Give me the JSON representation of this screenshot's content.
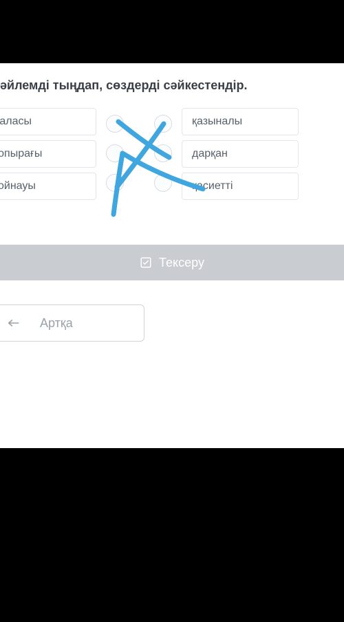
{
  "instruction": "әйлемді тыңдап, сөздерді сәйкестендір.",
  "match": {
    "left": [
      "даласы",
      "топырағы",
      "қойнауы"
    ],
    "right": [
      "қазыналы",
      "дарқан",
      "қасиетті"
    ],
    "connections": [
      {
        "from": 0,
        "to": 1
      },
      {
        "from": 1,
        "to": 2
      },
      {
        "from": 2,
        "to": 0
      }
    ]
  },
  "buttons": {
    "check": "Тексеру",
    "back": "Артқа"
  },
  "colors": {
    "line": "#3fa6df",
    "panelBorder": "#e3e6ea",
    "muted": "#9aa1a8",
    "checkBg": "#c9ccd0"
  }
}
